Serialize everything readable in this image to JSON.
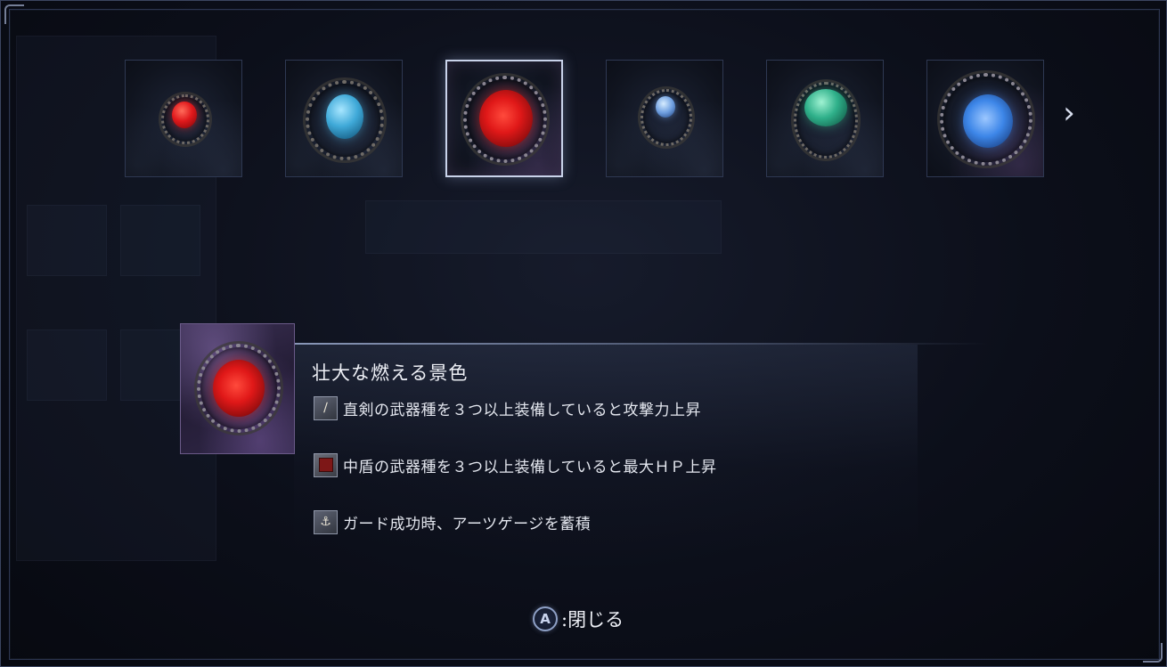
{
  "carousel": {
    "items": [
      {
        "name": "red-gem-item",
        "gem_color": "#e0191c",
        "nest": "small"
      },
      {
        "name": "blue-coral-gem-item",
        "gem_color": "#3fa9d8",
        "nest": "coral"
      },
      {
        "name": "red-crescent-gem-item",
        "gem_color": "#e01818",
        "nest": "crescent",
        "selected": true
      },
      {
        "name": "small-blue-gem-item",
        "gem_color": "#6f9fe0",
        "nest": "small"
      },
      {
        "name": "green-gem-item",
        "gem_color": "#2fb08a",
        "nest": "large"
      },
      {
        "name": "blue-crescent-gem-item",
        "gem_color": "#3d86e8",
        "nest": "crescent"
      }
    ],
    "next_icon": "chevron-right-icon"
  },
  "detail": {
    "title": "壮大な燃える景色",
    "effects": [
      {
        "icon": "straight-sword-icon",
        "text": "直剣の武器種を３つ以上装備していると攻撃力上昇"
      },
      {
        "icon": "medium-shield-icon",
        "text": "中盾の武器種を３つ以上装備していると最大ＨＰ上昇"
      },
      {
        "icon": "guard-icon",
        "text": "ガード成功時、アーツゲージを蓄積"
      }
    ]
  },
  "footer": {
    "button_glyph": "A",
    "close_label": ":閉じる"
  },
  "colors": {
    "background": "#0c0f1a",
    "frame_border": "#3b4560",
    "selected_border": "#c9d3ea",
    "detail_icon_bg": "#2f2646"
  }
}
